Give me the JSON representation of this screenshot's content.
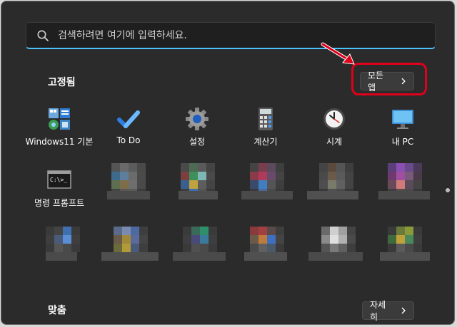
{
  "search": {
    "placeholder": "검색하려면 여기에 입력하세요."
  },
  "pinned": {
    "title": "고정됨",
    "all_apps_label": "모든 앱",
    "apps": [
      {
        "label": "Windows11 기본",
        "icon": "windows-tools-icon"
      },
      {
        "label": "To Do",
        "icon": "todo-check-icon"
      },
      {
        "label": "설정",
        "icon": "settings-gear-icon"
      },
      {
        "label": "계산기",
        "icon": "calculator-icon"
      },
      {
        "label": "시계",
        "icon": "clock-icon"
      },
      {
        "label": "내 PC",
        "icon": "monitor-icon"
      },
      {
        "label": "명령 프롬프트",
        "icon": "command-prompt-icon"
      }
    ]
  },
  "recommended": {
    "title": "맞춤",
    "more_label": "자세히"
  },
  "colors": {
    "accent": "#4cc2ff",
    "annotation": "#e0001b",
    "background": "#2b2b2b"
  }
}
